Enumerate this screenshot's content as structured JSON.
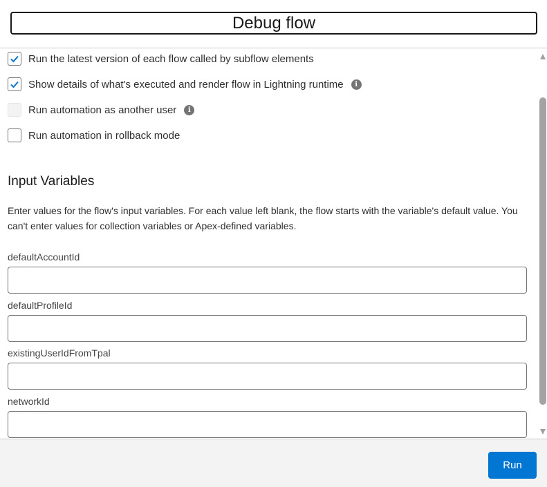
{
  "header": {
    "title": "Debug flow"
  },
  "options": [
    {
      "label": "Run the latest version of each flow called by subflow elements",
      "checked": true,
      "disabled": false,
      "info": false
    },
    {
      "label": "Show details of what's executed and render flow in Lightning runtime",
      "checked": true,
      "disabled": false,
      "info": true
    },
    {
      "label": "Run automation as another user",
      "checked": false,
      "disabled": true,
      "info": true
    },
    {
      "label": "Run automation in rollback mode",
      "checked": false,
      "disabled": false,
      "info": false
    }
  ],
  "input_section": {
    "title": "Input Variables",
    "description": "Enter values for the flow's input variables. For each value left blank, the flow starts with the variable's default value. You can't enter values for collection variables or Apex-defined variables.",
    "fields": [
      {
        "label": "defaultAccountId",
        "value": ""
      },
      {
        "label": "defaultProfileId",
        "value": ""
      },
      {
        "label": "existingUserIdFromTpal",
        "value": ""
      },
      {
        "label": "networkId",
        "value": ""
      }
    ]
  },
  "footer": {
    "run_label": "Run"
  },
  "colors": {
    "brand": "#0176d3",
    "check": "#0176d3",
    "footer_bg": "#f3f3f3",
    "info_icon": "#747474"
  },
  "icons": {
    "checkbox_check": "checkmark-icon",
    "info": "info-icon"
  }
}
